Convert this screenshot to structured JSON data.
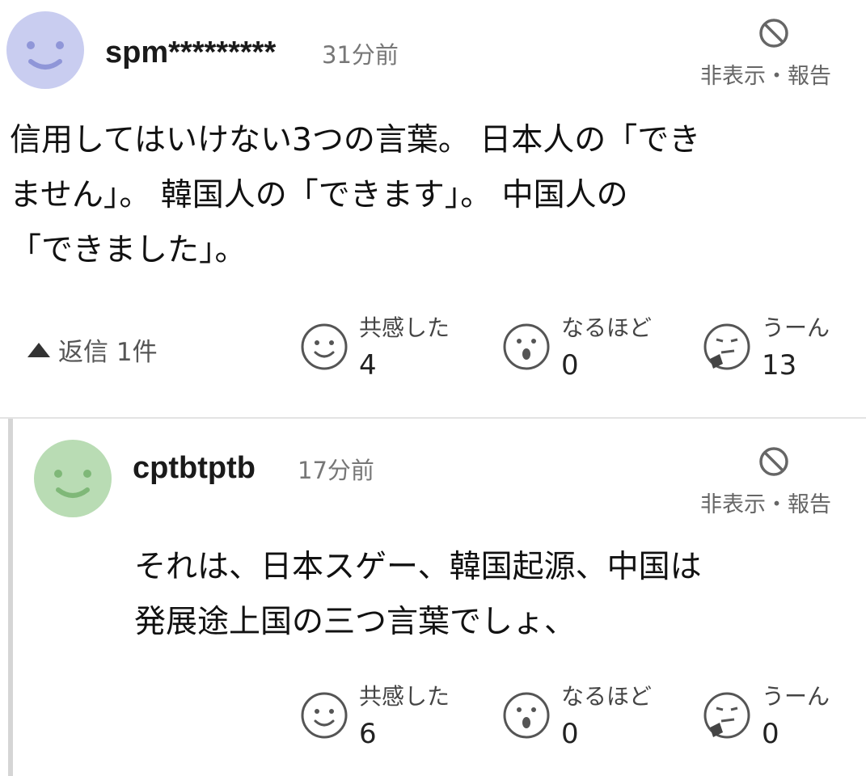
{
  "comments": [
    {
      "username": "spm*********",
      "time": "31分前",
      "hide_report": "非表示・報告",
      "avatar_color": "#c9cdf0",
      "text_lines": [
        "信用してはいけない3つの言葉。 日本人の「でき",
        "ません」。 韓国人の「できます」。 中国人の",
        "「できました」。"
      ],
      "reply_toggle": "返信 1件",
      "reactions": [
        {
          "icon": "smile-face-icon",
          "label": "共感した",
          "count": "4"
        },
        {
          "icon": "surprised-face-icon",
          "label": "なるほど",
          "count": "0"
        },
        {
          "icon": "thinking-face-icon",
          "label": "うーん",
          "count": "13"
        }
      ]
    },
    {
      "username": "cptbtptb",
      "time": "17分前",
      "hide_report": "非表示・報告",
      "avatar_color": "#b9dcb4",
      "text_lines": [
        "それは、日本スゲー、韓国起源、中国は",
        "発展途上国の三つ言葉でしょ、"
      ],
      "reactions": [
        {
          "icon": "smile-face-icon",
          "label": "共感した",
          "count": "6"
        },
        {
          "icon": "surprised-face-icon",
          "label": "なるほど",
          "count": "0"
        },
        {
          "icon": "thinking-face-icon",
          "label": "うーん",
          "count": "0"
        }
      ]
    }
  ]
}
